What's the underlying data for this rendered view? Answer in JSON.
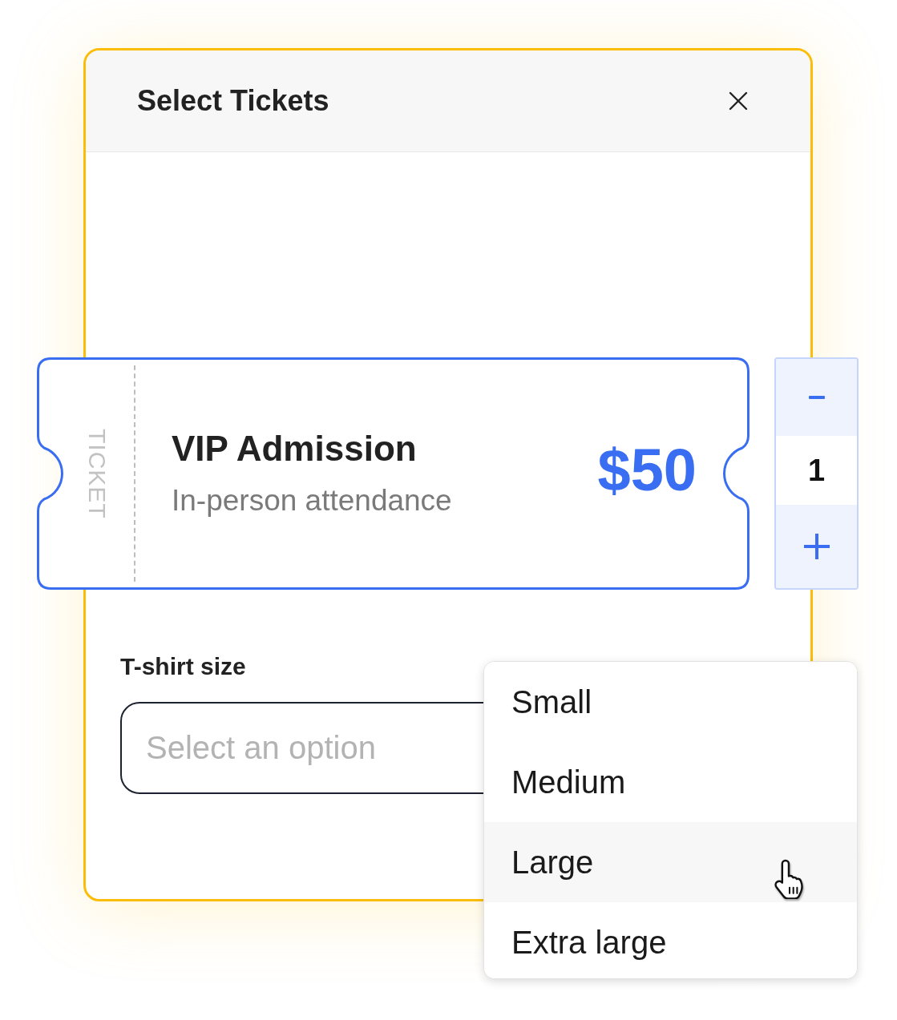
{
  "dialog": {
    "title": "Select Tickets"
  },
  "ticket": {
    "stub_label": "TICKET",
    "name": "VIP Admission",
    "description": "In-person attendance",
    "price": "$50"
  },
  "quantity": {
    "value": "1"
  },
  "tshirt_size": {
    "label": "T-shirt size",
    "placeholder": "Select an option",
    "expanded": true,
    "options": [
      {
        "label": "Small",
        "highlighted": false
      },
      {
        "label": "Medium",
        "highlighted": false
      },
      {
        "label": "Large",
        "highlighted": true
      },
      {
        "label": "Extra large",
        "highlighted": false
      }
    ]
  }
}
